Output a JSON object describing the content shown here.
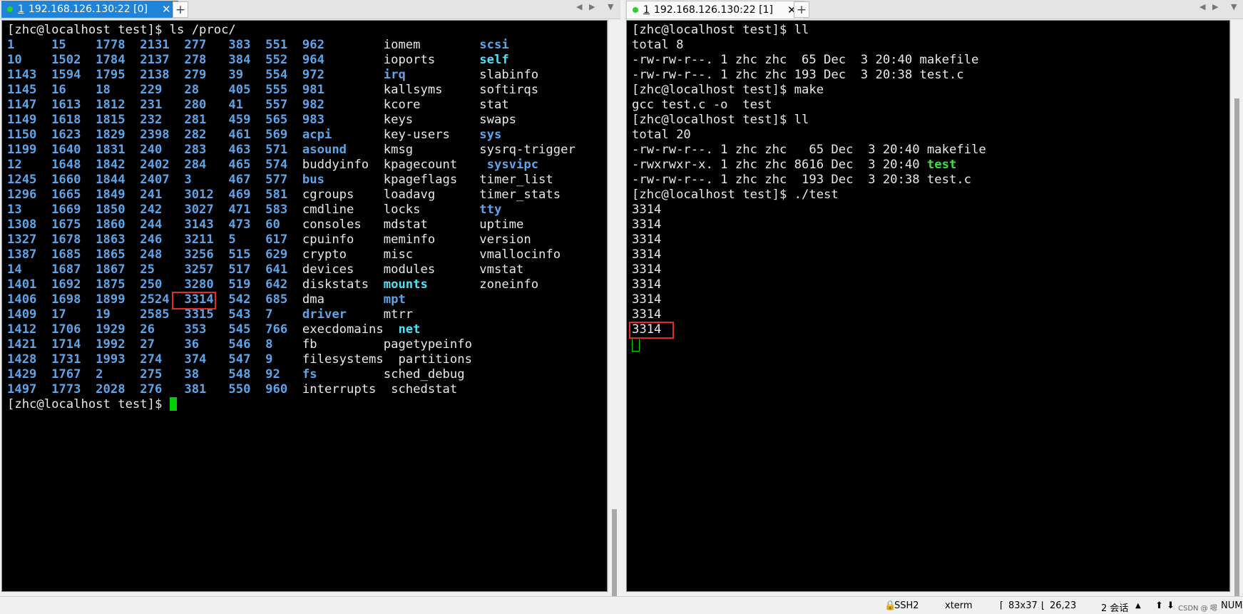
{
  "left_pane": {
    "tab": {
      "index": "1",
      "title": "192.168.126.130:22 [0]"
    },
    "terminal_lines": [
      [
        {
          "t": "[zhc@localhost test]$ ls /proc/"
        }
      ],
      [
        {
          "t": "1     15    1778  2131  277   383  551  962        ",
          "c": "blue"
        },
        {
          "t": "iomem        "
        },
        {
          "t": "scsi",
          "c": "blue"
        }
      ],
      [
        {
          "t": "10    1502  1784  2137  278   384  552  964        ",
          "c": "blue"
        },
        {
          "t": "ioports      "
        },
        {
          "t": "self",
          "c": "cyan"
        }
      ],
      [
        {
          "t": "1143  1594  1795  2138  279   39   554  972        ",
          "c": "blue"
        },
        {
          "t": "irq",
          "c": "blue"
        },
        {
          "t": "          slabinfo"
        }
      ],
      [
        {
          "t": "1145  16    18    229   28    405  555  981        ",
          "c": "blue"
        },
        {
          "t": "kallsyms     softirqs"
        }
      ],
      [
        {
          "t": "1147  1613  1812  231   280   41   557  982        ",
          "c": "blue"
        },
        {
          "t": "kcore        stat"
        }
      ],
      [
        {
          "t": "1149  1618  1815  232   281   459  565  983        ",
          "c": "blue"
        },
        {
          "t": "keys         swaps"
        }
      ],
      [
        {
          "t": "1150  1623  1829  2398  282   461  569  ",
          "c": "blue"
        },
        {
          "t": "acpi",
          "c": "blue"
        },
        {
          "t": "       key-users    "
        },
        {
          "t": "sys",
          "c": "blue"
        }
      ],
      [
        {
          "t": "1199  1640  1831  240   283   463  571  ",
          "c": "blue"
        },
        {
          "t": "asound",
          "c": "blue"
        },
        {
          "t": "     kmsg         sysrq-trigger"
        }
      ],
      [
        {
          "t": "12    1648  1842  2402  284   465  574  ",
          "c": "blue"
        },
        {
          "t": "buddyinfo  kpagecount    "
        },
        {
          "t": "sysvipc",
          "c": "blue"
        }
      ],
      [
        {
          "t": "1245  1660  1844  2407  3     467  577  ",
          "c": "blue"
        },
        {
          "t": "bus",
          "c": "blue"
        },
        {
          "t": "        kpageflags   timer_list"
        }
      ],
      [
        {
          "t": "1296  1665  1849  241   3012  469  581  ",
          "c": "blue"
        },
        {
          "t": "cgroups    loadavg      timer_stats"
        }
      ],
      [
        {
          "t": "13    1669  1850  242   3027  471  583  ",
          "c": "blue"
        },
        {
          "t": "cmdline    locks        "
        },
        {
          "t": "tty",
          "c": "blue"
        }
      ],
      [
        {
          "t": "1308  1675  1860  244   3143  473  60   ",
          "c": "blue"
        },
        {
          "t": "consoles   mdstat       uptime"
        }
      ],
      [
        {
          "t": "1327  1678  1863  246   3211  5    617  ",
          "c": "blue"
        },
        {
          "t": "cpuinfo    meminfo      version"
        }
      ],
      [
        {
          "t": "1387  1685  1865  248   3256  515  629  ",
          "c": "blue"
        },
        {
          "t": "crypto     misc         vmallocinfo"
        }
      ],
      [
        {
          "t": "14    1687  1867  25    3257  517  641  ",
          "c": "blue"
        },
        {
          "t": "devices    modules      vmstat"
        }
      ],
      [
        {
          "t": "1401  1692  1875  250   3280  519  642  ",
          "c": "blue"
        },
        {
          "t": "diskstats  "
        },
        {
          "t": "mounts",
          "c": "cyan"
        },
        {
          "t": "       zoneinfo"
        }
      ],
      [
        {
          "t": "1406  1698  1899  2524  3314  542  685  ",
          "c": "blue"
        },
        {
          "t": "dma        "
        },
        {
          "t": "mpt",
          "c": "blue"
        }
      ],
      [
        {
          "t": "1409  17    19    2585  3315  543  7    ",
          "c": "blue"
        },
        {
          "t": "driver",
          "c": "blue"
        },
        {
          "t": "     mtrr"
        }
      ],
      [
        {
          "t": "1412  1706  1929  26    353   545  766  ",
          "c": "blue"
        },
        {
          "t": "execdomains  "
        },
        {
          "t": "net",
          "c": "cyan"
        }
      ],
      [
        {
          "t": "1421  1714  1992  27    36    546  8    ",
          "c": "blue"
        },
        {
          "t": "fb         pagetypeinfo"
        }
      ],
      [
        {
          "t": "1428  1731  1993  274   374   547  9    ",
          "c": "blue"
        },
        {
          "t": "filesystems  partitions"
        }
      ],
      [
        {
          "t": "1429  1767  2     275   38    548  92   ",
          "c": "blue"
        },
        {
          "t": "fs",
          "c": "blue"
        },
        {
          "t": "         sched_debug"
        }
      ],
      [
        {
          "t": "1497  1773  2028  276   381   550  960  ",
          "c": "blue"
        },
        {
          "t": "interrupts  schedstat"
        }
      ],
      [
        {
          "t": "[zhc@localhost test]$ "
        },
        {
          "cursor": "solid"
        }
      ]
    ]
  },
  "right_pane": {
    "tab": {
      "index": "1",
      "title": "192.168.126.130:22 [1]"
    },
    "terminal_lines": [
      [
        {
          "t": "[zhc@localhost test]$ ll"
        }
      ],
      [
        {
          "t": "total 8"
        }
      ],
      [
        {
          "t": "-rw-rw-r--. 1 zhc zhc  65 Dec  3 20:40 makefile"
        }
      ],
      [
        {
          "t": "-rw-rw-r--. 1 zhc zhc 193 Dec  3 20:38 test.c"
        }
      ],
      [
        {
          "t": "[zhc@localhost test]$ make"
        }
      ],
      [
        {
          "t": "gcc test.c -o  test"
        }
      ],
      [
        {
          "t": "[zhc@localhost test]$ ll"
        }
      ],
      [
        {
          "t": "total 20"
        }
      ],
      [
        {
          "t": "-rw-rw-r--. 1 zhc zhc   65 Dec  3 20:40 makefile"
        }
      ],
      [
        {
          "t": "-rwxrwxr-x. 1 zhc zhc 8616 Dec  3 20:40 "
        },
        {
          "t": "test",
          "c": "green"
        }
      ],
      [
        {
          "t": "-rw-rw-r--. 1 zhc zhc  193 Dec  3 20:38 test.c"
        }
      ],
      [
        {
          "t": "[zhc@localhost test]$ ./test"
        }
      ],
      [
        {
          "t": "3314"
        }
      ],
      [
        {
          "t": "3314"
        }
      ],
      [
        {
          "t": "3314"
        }
      ],
      [
        {
          "t": "3314"
        }
      ],
      [
        {
          "t": "3314"
        }
      ],
      [
        {
          "t": "3314"
        }
      ],
      [
        {
          "t": "3314"
        }
      ],
      [
        {
          "t": "3314"
        }
      ],
      [
        {
          "t": "3314"
        }
      ],
      [
        {
          "cursor": "hollow"
        }
      ]
    ]
  },
  "statusbar": {
    "protocol": "SSH2",
    "term_type": "xterm",
    "size": "83x37",
    "cursor_pos": "26,23",
    "sessions": "2 会话",
    "num": "NUM",
    "watermark": "CSDN @ 嗯"
  },
  "colors": {
    "tab_active": "#1f84d8",
    "dir_blue": "#5da4e8",
    "link_cyan": "#4de1f5",
    "exec_green": "#3be03b",
    "highlight_red": "#e52a2a"
  }
}
